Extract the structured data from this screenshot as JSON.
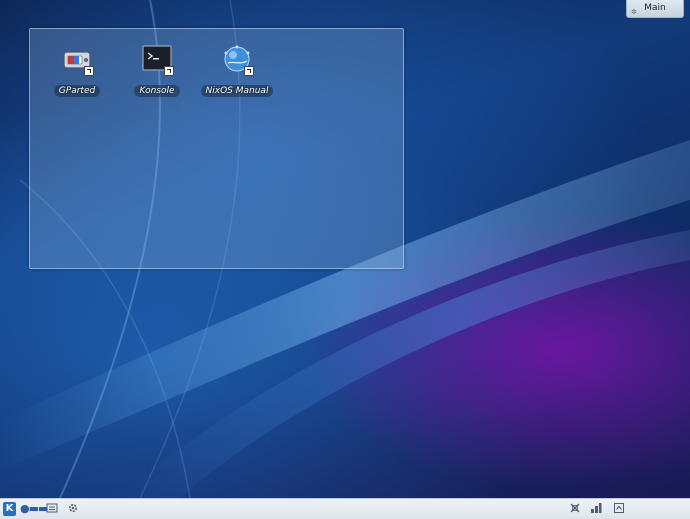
{
  "desktop": {
    "folder_view": {
      "icons": [
        {
          "label": "GParted",
          "icon": "gparted-icon"
        },
        {
          "label": "Konsole",
          "icon": "konsole-icon"
        },
        {
          "label": "NixOS Manual",
          "icon": "nixos-manual-icon"
        }
      ]
    }
  },
  "activities": {
    "label": "Main",
    "icon": "activities-icon"
  },
  "panel": {
    "launcher_icon": "kde-launcher-icon",
    "launcher_glyph": "K",
    "pager_glyph": "●▬▬",
    "task_icons": [
      "task-manager-icon",
      "settings-gear-icon"
    ],
    "tray_icons": [
      "clipboard-icon",
      "network-icon",
      "tray-expand-icon"
    ]
  },
  "colors": {
    "panel_bg": "#eef2f6",
    "accent": "#2b6fb6",
    "folder_view_tint": "#96bee1"
  }
}
